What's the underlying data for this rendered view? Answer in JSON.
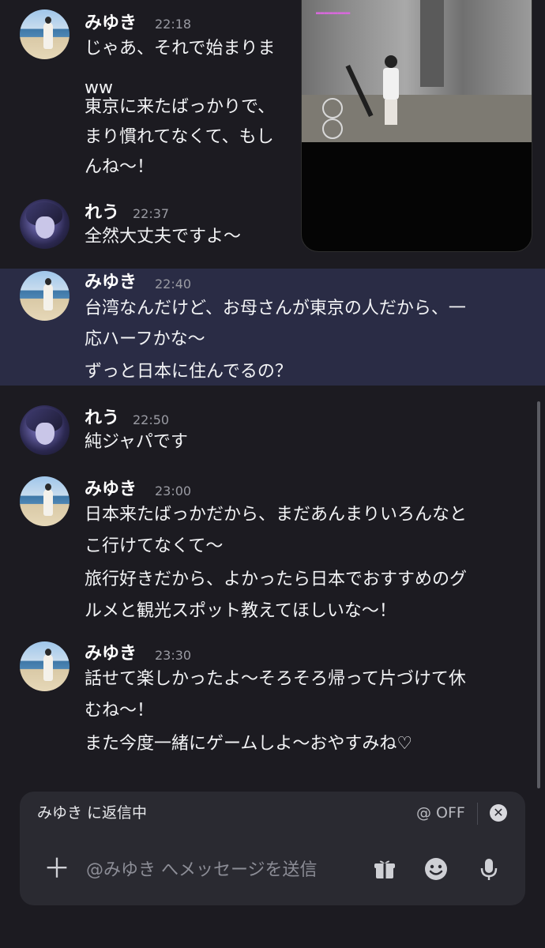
{
  "messages": [
    {
      "user": "みゆき",
      "time": "22:18",
      "avatar": "beach-avatar",
      "lines": [
        "じゃあ、それで始まりま",
        "ww",
        "東京に来たばっかりで、",
        "まり慣れてなくて、もし",
        "んね〜！"
      ]
    },
    {
      "user": "れう",
      "time": "22:37",
      "avatar": "anime-avatar",
      "lines": [
        "全然大丈夫ですよ〜"
      ]
    },
    {
      "user": "みゆき",
      "time": "22:40",
      "avatar": "beach-avatar",
      "highlighted": true,
      "lines": [
        "台湾なんだけど、お母さんが東京の人だから、一",
        "応ハーフかな〜",
        "ずっと日本に住んでるの？"
      ]
    },
    {
      "user": "れう",
      "time": "22:50",
      "avatar": "anime-avatar",
      "lines": [
        "純ジャパです"
      ]
    },
    {
      "user": "みゆき",
      "time": "23:00",
      "avatar": "beach-avatar",
      "lines": [
        "日本来たばっかだから、まだあんまりいろんなと",
        "こ行けてなくて〜",
        "旅行好きだから、よかったら日本でおすすめのグ",
        "ルメと観光スポット教えてほしいな〜！"
      ]
    },
    {
      "user": "みゆき",
      "time": "23:30",
      "avatar": "beach-avatar",
      "lines": [
        "話せて楽しかったよ〜そろそろ帰って片づけて休",
        "むね〜！",
        "また今度一緒にゲームしよ〜おやすみね♡"
      ]
    }
  ],
  "composer": {
    "reply_label": "みゆき に返信中",
    "mention_toggle": "@ OFF",
    "close_glyph": "✕",
    "plus_glyph": "＋",
    "placeholder": "@みゆき へメッセージを送信",
    "icons": [
      "gift-icon",
      "emoji-icon",
      "microphone-icon"
    ]
  },
  "colors": {
    "background": "#1c1b21",
    "highlight": "#2a2c45",
    "composer": "#2a2a31",
    "timestamp": "#9a9ba3"
  }
}
